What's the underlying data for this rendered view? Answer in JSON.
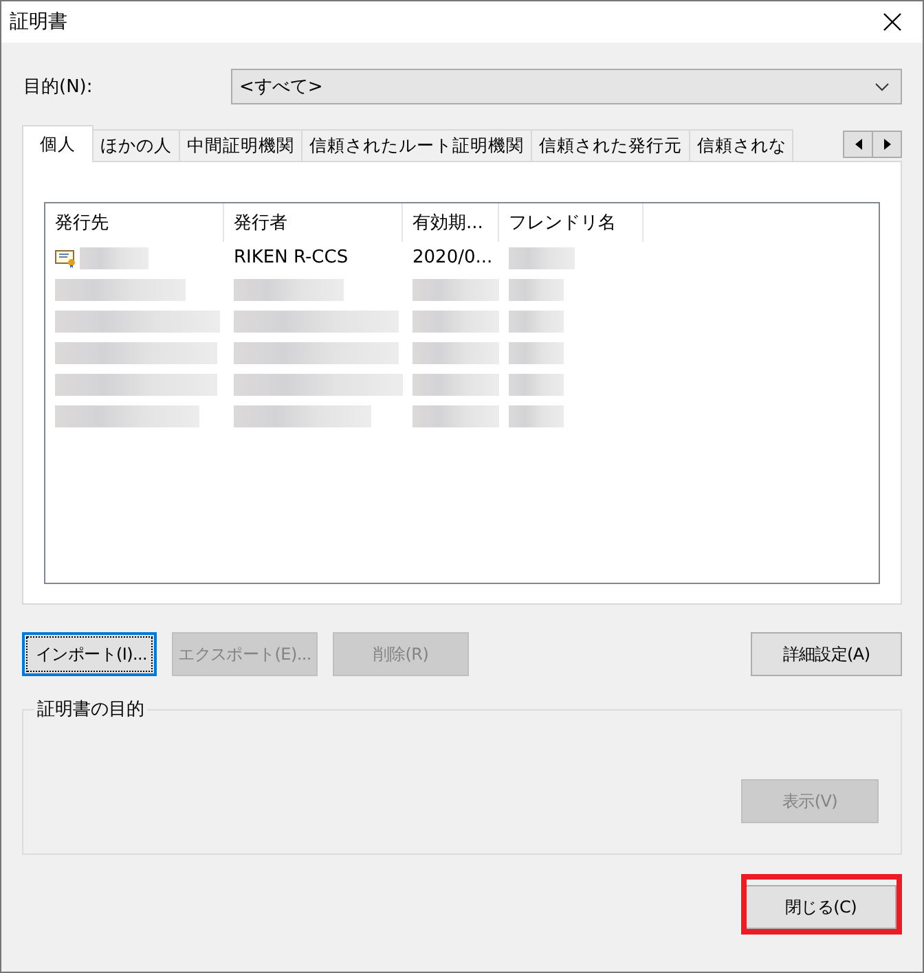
{
  "window": {
    "title": "証明書"
  },
  "purpose": {
    "label": "目的(N):",
    "value": "<すべて>"
  },
  "tabs": [
    {
      "label": "個人",
      "selected": true
    },
    {
      "label": "ほかの人",
      "selected": false
    },
    {
      "label": "中間証明機関",
      "selected": false
    },
    {
      "label": "信頼されたルート証明機関",
      "selected": false
    },
    {
      "label": "信頼された発行元",
      "selected": false
    },
    {
      "label": "信頼されな",
      "selected": false
    }
  ],
  "table": {
    "columns": [
      "発行先",
      "発行者",
      "有効期...",
      "フレンドリ名"
    ],
    "rows": [
      {
        "cells": [
          {
            "kind": "blurred",
            "icon": true
          },
          {
            "kind": "text",
            "text": "RIKEN R-CCS"
          },
          {
            "kind": "text",
            "text": "2020/0..."
          },
          {
            "kind": "blurred"
          }
        ]
      },
      {
        "cells": [
          {
            "kind": "blurred"
          },
          {
            "kind": "blurred"
          },
          {
            "kind": "blurred"
          },
          {
            "kind": "blurred"
          }
        ]
      },
      {
        "cells": [
          {
            "kind": "blurred"
          },
          {
            "kind": "blurred"
          },
          {
            "kind": "blurred"
          },
          {
            "kind": "blurred"
          }
        ]
      },
      {
        "cells": [
          {
            "kind": "blurred"
          },
          {
            "kind": "blurred"
          },
          {
            "kind": "blurred"
          },
          {
            "kind": "blurred"
          }
        ]
      },
      {
        "cells": [
          {
            "kind": "blurred"
          },
          {
            "kind": "blurred"
          },
          {
            "kind": "blurred"
          },
          {
            "kind": "blurred"
          }
        ]
      },
      {
        "cells": [
          {
            "kind": "blurred"
          },
          {
            "kind": "blurred"
          },
          {
            "kind": "blurred"
          },
          {
            "kind": "blurred"
          }
        ]
      }
    ]
  },
  "buttons": [
    {
      "label": "インポート(I)...",
      "disabled": false,
      "focused": true
    },
    {
      "label": "エクスポート(E)...",
      "disabled": true,
      "focused": false
    },
    {
      "label": "削除(R)",
      "disabled": true,
      "focused": false
    },
    {
      "label": "詳細設定(A)",
      "disabled": false,
      "focused": false
    }
  ],
  "purpose_group": {
    "title": "証明書の目的",
    "button": {
      "label": "表示(V)",
      "disabled": true
    }
  },
  "close_button": {
    "label": "閉じる(C)",
    "highlighted": true
  }
}
